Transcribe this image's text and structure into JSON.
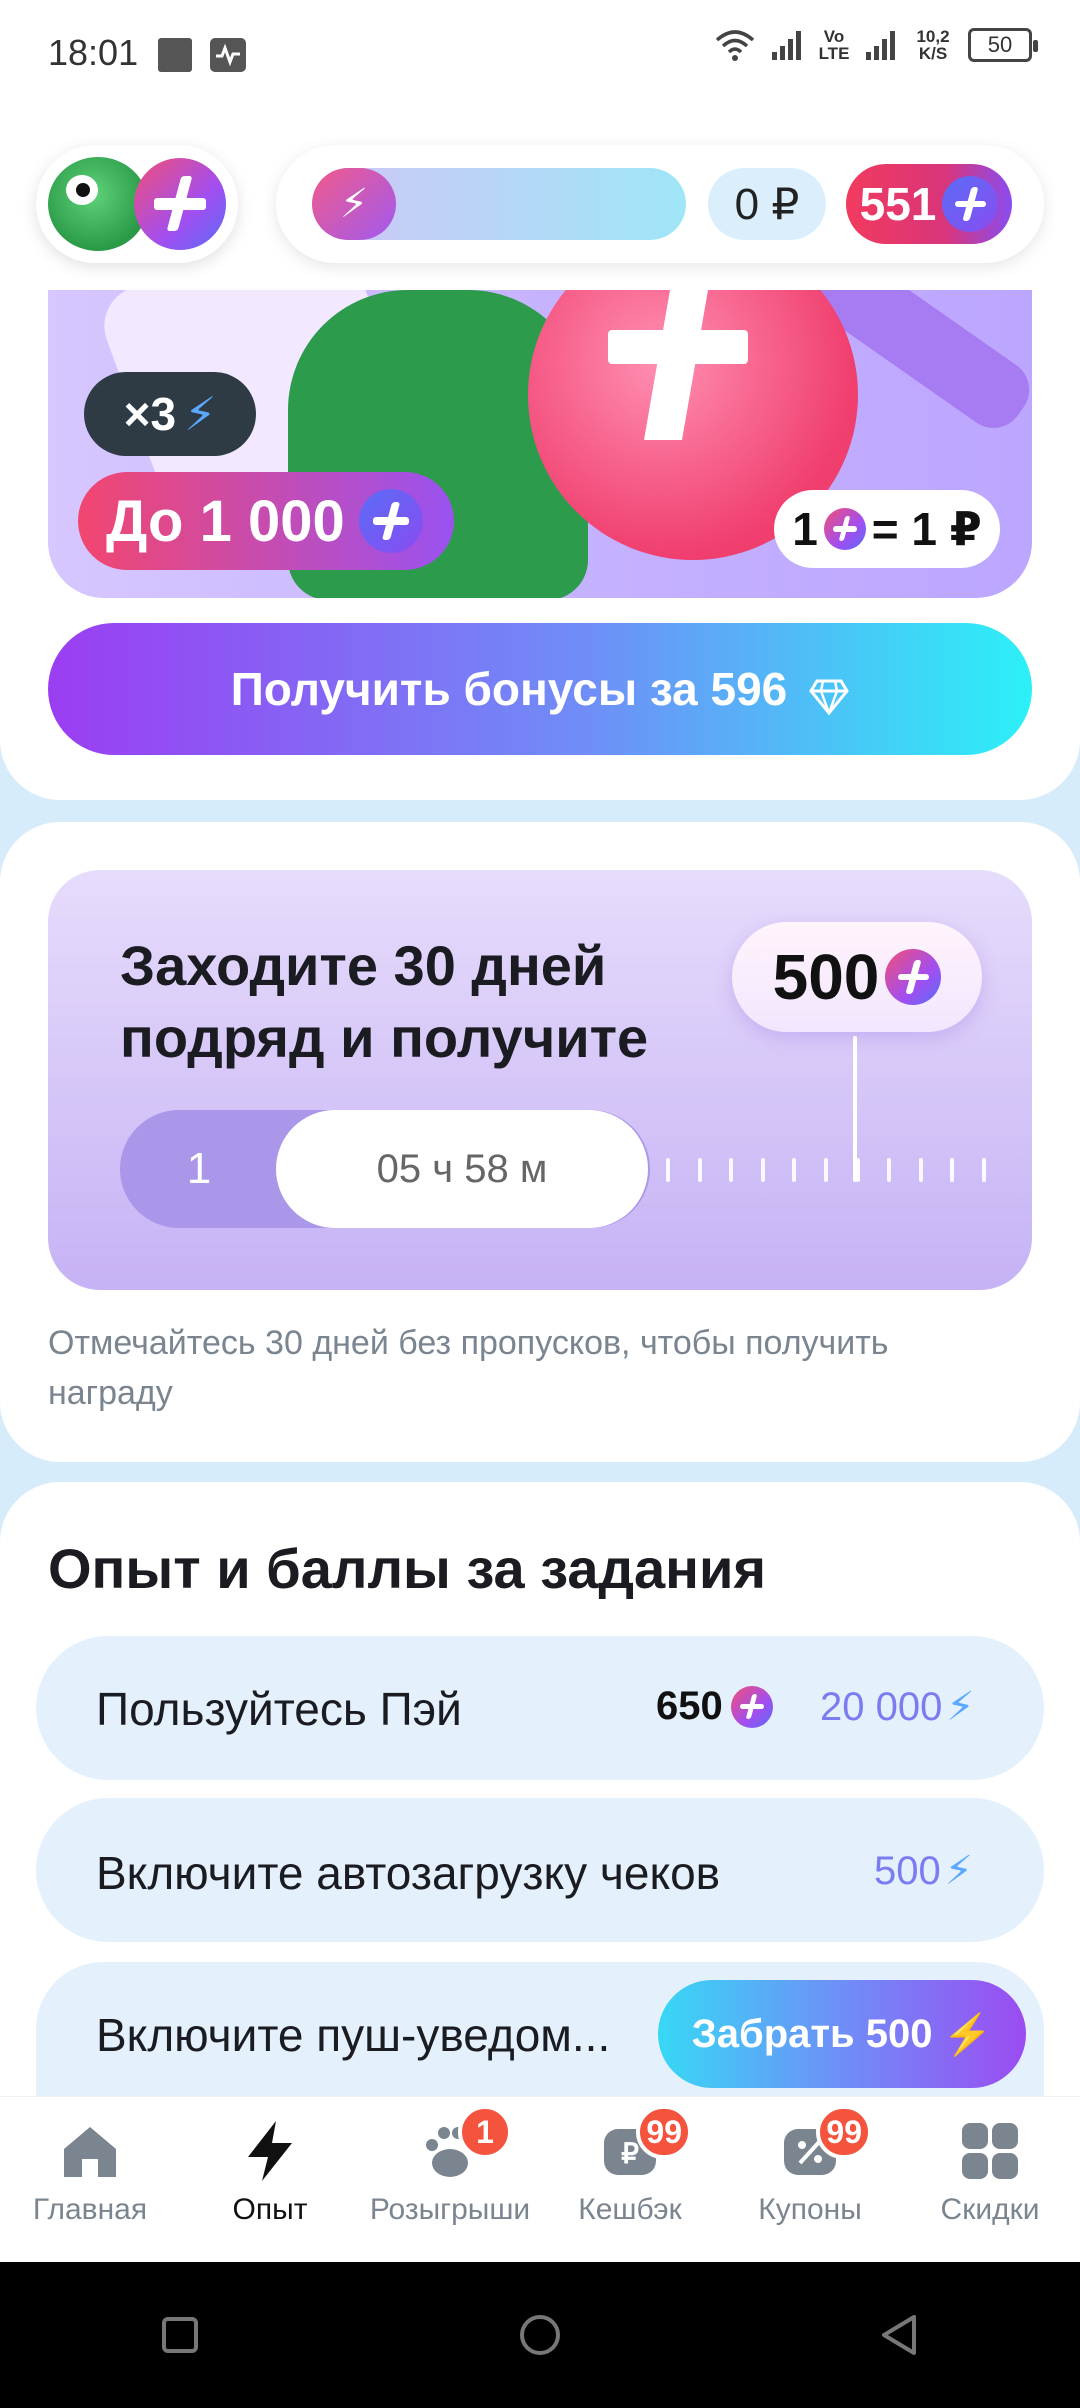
{
  "status_bar": {
    "time": "18:01",
    "volte": "Vo LTE",
    "speed": "10,2 K/S",
    "battery": "50"
  },
  "header": {
    "rub_balance": "0 ₽",
    "points_balance": "551"
  },
  "banner": {
    "multiplier": "×3",
    "upto_label": "До 1 000",
    "rate_left": "1",
    "rate_right": "= 1 ₽"
  },
  "bonus_button": {
    "label": "Получить бонусы за 596"
  },
  "streak": {
    "title": "Заходите 30 дней подряд и получите",
    "reward": "500",
    "current_day": "1",
    "timer": "05 ч 58 м",
    "note": "Отмечайтесь 30 дней без пропусков, чтобы получить награду"
  },
  "tasks": {
    "title": "Опыт и баллы за задания",
    "items": [
      {
        "label": "Пользуйтесь Пэй",
        "points": "650",
        "xp": "20 000"
      },
      {
        "label": "Включите автозагрузку чеков",
        "xp": "500"
      },
      {
        "label": "Включите пуш-уведом...",
        "button": "Забрать 500"
      }
    ]
  },
  "bottom_nav": {
    "items": [
      {
        "label": "Главная",
        "icon": "home-icon"
      },
      {
        "label": "Опыт",
        "icon": "bolt-icon",
        "active": true
      },
      {
        "label": "Розыгрыши",
        "icon": "paw-icon",
        "badge": "1"
      },
      {
        "label": "Кешбэк",
        "icon": "cashback-icon",
        "badge": "99"
      },
      {
        "label": "Купоны",
        "icon": "coupon-icon",
        "badge": "99"
      },
      {
        "label": "Скидки",
        "icon": "grid-icon"
      }
    ]
  },
  "colors": {
    "accent_gradient_start": "#9b3df2",
    "accent_gradient_end": "#2cf0f7",
    "badge": "#f4533e",
    "task_bg": "#e4f1fc"
  }
}
